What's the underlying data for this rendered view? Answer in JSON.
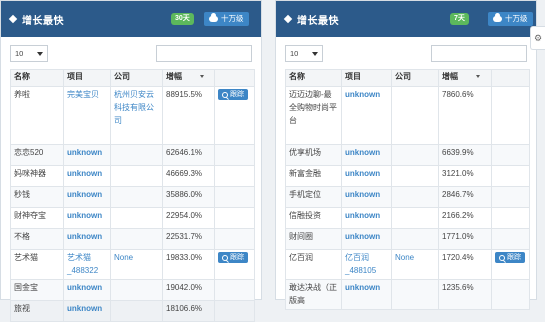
{
  "left_panel": {
    "title": "增长最快",
    "badge": "30天",
    "scale_button": "十万级",
    "page_size": "10",
    "columns": [
      "名称",
      "项目",
      "公司",
      "增幅"
    ],
    "rows": [
      {
        "name": "养啦",
        "project": "完美宝贝",
        "company": "杭州贝安云科技有限公司",
        "growth": "88915.5%",
        "track": "跟踪"
      },
      {
        "name": "恋恋520",
        "project": "unknown",
        "company": "",
        "growth": "62646.1%",
        "track": ""
      },
      {
        "name": "妈咪神器",
        "project": "unknown",
        "company": "",
        "growth": "46669.3%",
        "track": ""
      },
      {
        "name": "秒钱",
        "project": "unknown",
        "company": "",
        "growth": "35886.0%",
        "track": ""
      },
      {
        "name": "财神夺宝",
        "project": "unknown",
        "company": "",
        "growth": "22954.0%",
        "track": ""
      },
      {
        "name": "不格",
        "project": "unknown",
        "company": "",
        "growth": "22531.7%",
        "track": ""
      },
      {
        "name": "艺术猫",
        "project": "艺术猫_488322",
        "company": "None",
        "growth": "19833.0%",
        "track": "跟踪"
      },
      {
        "name": "国金宝",
        "project": "unknown",
        "company": "",
        "growth": "19042.0%",
        "track": ""
      },
      {
        "name": "旅视",
        "project": "unknown",
        "company": "",
        "growth": "18106.6%",
        "track": ""
      }
    ]
  },
  "right_panel": {
    "title": "增长最快",
    "badge": "7天",
    "scale_button": "十万级",
    "page_size": "10",
    "columns": [
      "名称",
      "项目",
      "公司",
      "增幅"
    ],
    "rows": [
      {
        "name": "迈迈边聊-最全购物时尚平台",
        "project": "unknown",
        "company": "",
        "growth": "7860.6%",
        "track": ""
      },
      {
        "name": "优享机场",
        "project": "unknown",
        "company": "",
        "growth": "6639.9%",
        "track": ""
      },
      {
        "name": "新富金融",
        "project": "unknown",
        "company": "",
        "growth": "3121.0%",
        "track": ""
      },
      {
        "name": "手机定位",
        "project": "unknown",
        "company": "",
        "growth": "2846.7%",
        "track": ""
      },
      {
        "name": "信融投资",
        "project": "unknown",
        "company": "",
        "growth": "2166.2%",
        "track": ""
      },
      {
        "name": "财间圈",
        "project": "unknown",
        "company": "",
        "growth": "1771.0%",
        "track": ""
      },
      {
        "name": "亿百润",
        "project": "亿百润_488105",
        "company": "None",
        "growth": "1720.4%",
        "track": "跟踪"
      },
      {
        "name": "敢达决战（正版高",
        "project": "unknown",
        "company": "",
        "growth": "1235.6%",
        "track": ""
      }
    ]
  },
  "colors": {
    "header_bg": "#2c5a8a",
    "badge_green": "#5cb85c",
    "link_blue": "#3d86c6"
  }
}
